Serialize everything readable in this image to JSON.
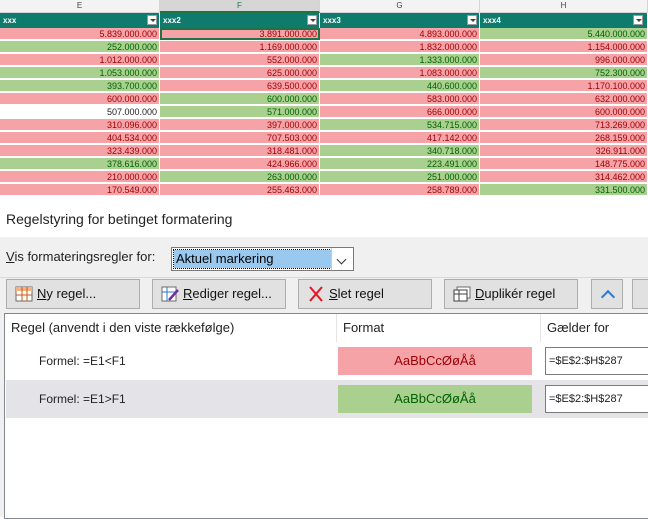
{
  "sheet": {
    "columns": [
      "E",
      "F",
      "G",
      "H"
    ],
    "table_headers": [
      "xxx",
      "xxx2",
      "xxx3",
      "xxx4"
    ],
    "rows": [
      [
        [
          "5.839.000.000",
          "r"
        ],
        [
          "3.891.000.000",
          "r"
        ],
        [
          "4.893.000.000",
          "r"
        ],
        [
          "5.440.000.000",
          "g"
        ]
      ],
      [
        [
          "252.000.000",
          "g"
        ],
        [
          "1.169.000.000",
          "r"
        ],
        [
          "1.832.000.000",
          "r"
        ],
        [
          "1.154.000.000",
          "r"
        ]
      ],
      [
        [
          "1.012.000.000",
          "r"
        ],
        [
          "552.000.000",
          "r"
        ],
        [
          "1.333.000.000",
          "g"
        ],
        [
          "996.000.000",
          "r"
        ]
      ],
      [
        [
          "1.053.000.000",
          "g"
        ],
        [
          "625.000.000",
          "r"
        ],
        [
          "1.083.000.000",
          "r"
        ],
        [
          "752.300.000",
          "g"
        ]
      ],
      [
        [
          "393.700.000",
          "g"
        ],
        [
          "639.500.000",
          "r"
        ],
        [
          "440.600.000",
          "g"
        ],
        [
          "1.170.100.000",
          "r"
        ]
      ],
      [
        [
          "600.000.000",
          "r"
        ],
        [
          "600.000.000",
          "g"
        ],
        [
          "583.000.000",
          "r"
        ],
        [
          "632.000.000",
          "r"
        ]
      ],
      [
        [
          "507.000.000",
          "w"
        ],
        [
          "571.000.000",
          "g"
        ],
        [
          "666.000.000",
          "r"
        ],
        [
          "600.000.000",
          "r"
        ]
      ],
      [
        [
          "310.096.000",
          "r"
        ],
        [
          "397.000.000",
          "r"
        ],
        [
          "534.715.000",
          "g"
        ],
        [
          "713.269.000",
          "r"
        ]
      ],
      [
        [
          "404.534.000",
          "r"
        ],
        [
          "707.503.000",
          "r"
        ],
        [
          "417.142.000",
          "r"
        ],
        [
          "268.159.000",
          "r"
        ]
      ],
      [
        [
          "323.439.000",
          "r"
        ],
        [
          "318.481.000",
          "r"
        ],
        [
          "340.718.000",
          "g"
        ],
        [
          "326.911.000",
          "r"
        ]
      ],
      [
        [
          "378.616.000",
          "g"
        ],
        [
          "424.966.000",
          "r"
        ],
        [
          "223.491.000",
          "g"
        ],
        [
          "148.775.000",
          "r"
        ]
      ],
      [
        [
          "210.000.000",
          "r"
        ],
        [
          "263.000.000",
          "g"
        ],
        [
          "251.000.000",
          "g"
        ],
        [
          "314.462.000",
          "r"
        ]
      ],
      [
        [
          "170.549.000",
          "r"
        ],
        [
          "255.463.000",
          "r"
        ],
        [
          "258.789.000",
          "r"
        ],
        [
          "331.500.000",
          "g"
        ]
      ]
    ]
  },
  "dialog": {
    "title": "Regelstyring for betinget formatering",
    "show_rules_for_label_pre": "V",
    "show_rules_for_label_post": "is formateringsregler for:",
    "show_rules_for_value": "Aktuel markering",
    "buttons": {
      "new_u": "N",
      "new_rest": "y regel...",
      "edit_u": "R",
      "edit_rest": "ediger regel...",
      "delete_u": "S",
      "delete_rest": "let regel",
      "duplicate_u": "D",
      "duplicate_rest": "uplikér regel"
    },
    "columns": {
      "rule": "Regel (anvendt i den viste rækkefølge)",
      "format": "Format",
      "applies_to": "Gælder for"
    },
    "rules": [
      {
        "name": "Formel: =E1<F1",
        "sample": "AaBbCcØøÅå",
        "sample_bg": "#f5a3a6",
        "sample_fg": "#9c0006",
        "applies_to": "=$E$2:$H$287"
      },
      {
        "name": "Formel: =E1>F1",
        "sample": "AaBbCcØøÅå",
        "sample_bg": "#a9d08e",
        "sample_fg": "#006100",
        "applies_to": "=$E$2:$H$287"
      }
    ]
  }
}
